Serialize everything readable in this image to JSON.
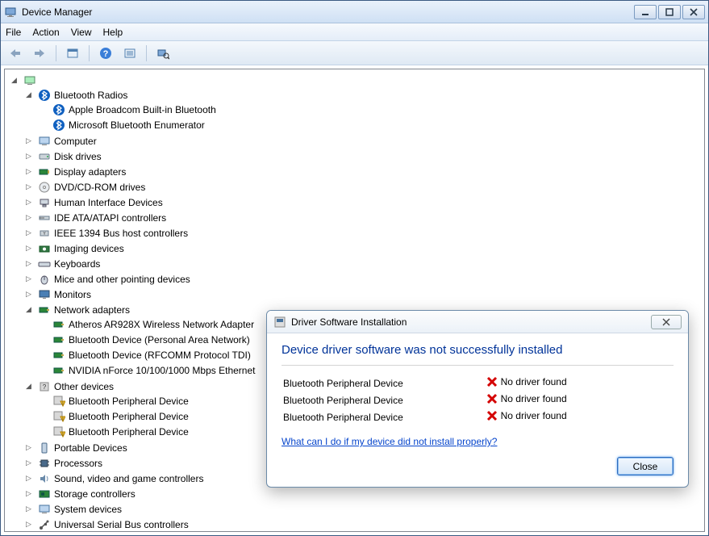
{
  "window": {
    "title": "Device Manager"
  },
  "menu": {
    "file": "File",
    "action": "Action",
    "view": "View",
    "help": "Help"
  },
  "toolbar": {
    "back": "back",
    "forward": "forward",
    "show_hidden": "show-hidden",
    "help": "help",
    "properties": "properties",
    "scan": "scan"
  },
  "tree": {
    "root": "",
    "bluetooth_radios": "Bluetooth Radios",
    "bt_apple": "Apple Broadcom Built-in Bluetooth",
    "bt_ms_enum": "Microsoft Bluetooth Enumerator",
    "computer": "Computer",
    "disk_drives": "Disk drives",
    "display_adapters": "Display adapters",
    "dvd": "DVD/CD-ROM drives",
    "hid": "Human Interface Devices",
    "ide": "IDE ATA/ATAPI controllers",
    "ieee1394": "IEEE 1394 Bus host controllers",
    "imaging": "Imaging devices",
    "keyboards": "Keyboards",
    "mice": "Mice and other pointing devices",
    "monitors": "Monitors",
    "network_adapters": "Network adapters",
    "na_atheros": "Atheros AR928X Wireless Network Adapter",
    "na_bt_pan": "Bluetooth Device (Personal Area Network)",
    "na_bt_rfcomm": "Bluetooth Device (RFCOMM Protocol TDI)",
    "na_nvidia": "NVIDIA nForce 10/100/1000 Mbps Ethernet",
    "other_devices": "Other devices",
    "od_bpd_1": "Bluetooth Peripheral Device",
    "od_bpd_2": "Bluetooth Peripheral Device",
    "od_bpd_3": "Bluetooth Peripheral Device",
    "portable": "Portable Devices",
    "processors": "Processors",
    "sound": "Sound, video and game controllers",
    "storage": "Storage controllers",
    "system": "System devices",
    "usb": "Universal Serial Bus controllers"
  },
  "dialog": {
    "title": "Driver Software Installation",
    "heading": "Device driver software was not successfully installed",
    "rows": [
      {
        "device": "Bluetooth Peripheral Device",
        "status": "No driver found"
      },
      {
        "device": "Bluetooth Peripheral Device",
        "status": "No driver found"
      },
      {
        "device": "Bluetooth Peripheral Device",
        "status": "No driver found"
      }
    ],
    "help_link": "What can I do if my device did not install properly?",
    "close": "Close"
  }
}
